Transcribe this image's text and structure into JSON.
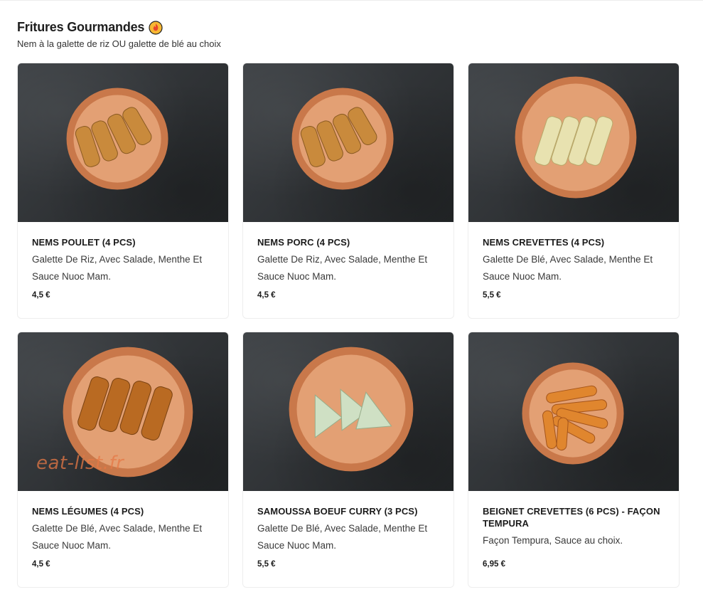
{
  "section": {
    "title": "Fritures Gourmandes",
    "subtitle": "Nem à la galette de riz OU galette de blé au choix",
    "icon": "fire-emoji-icon"
  },
  "products": [
    {
      "name": "NEMS POULET (4 PCS)",
      "description": "Galette De Riz, Avec Salade, Menthe Et Sauce Nuoc Mam.",
      "price": "4,5 €",
      "image": "nems-poulet-plate"
    },
    {
      "name": "NEMS PORC (4 PCS)",
      "description": "Galette De Riz, Avec Salade, Menthe Et Sauce Nuoc Mam.",
      "price": "4,5 €",
      "image": "nems-porc-plate"
    },
    {
      "name": "NEMS CREVETTES (4 PCS)",
      "description": "Galette De Blé, Avec Salade, Menthe Et Sauce Nuoc Mam.",
      "price": "5,5 €",
      "image": "nems-crevettes-plate"
    },
    {
      "name": "NEMS LÉGUMES (4 PCS)",
      "description": "Galette De Blé, Avec Salade, Menthe Et Sauce Nuoc Mam.",
      "price": "4,5 €",
      "image": "nems-legumes-plate"
    },
    {
      "name": "SAMOUSSA BOEUF CURRY (3 PCS)",
      "description": "Galette De Blé, Avec Salade, Menthe Et Sauce Nuoc Mam.",
      "price": "5,5 €",
      "image": "samoussa-plate"
    },
    {
      "name": "BEIGNET CREVETTES (6 PCS) - FAÇON TEMPURA",
      "description": "Façon Tempura, Sauce au choix.",
      "price": "6,95 €",
      "image": "beignet-crevettes-plate"
    }
  ],
  "watermark": "eat-list.fr",
  "colors": {
    "plate": "#d98a57",
    "plate_inner": "#e9a77a",
    "background_photo": "#2f3235"
  }
}
